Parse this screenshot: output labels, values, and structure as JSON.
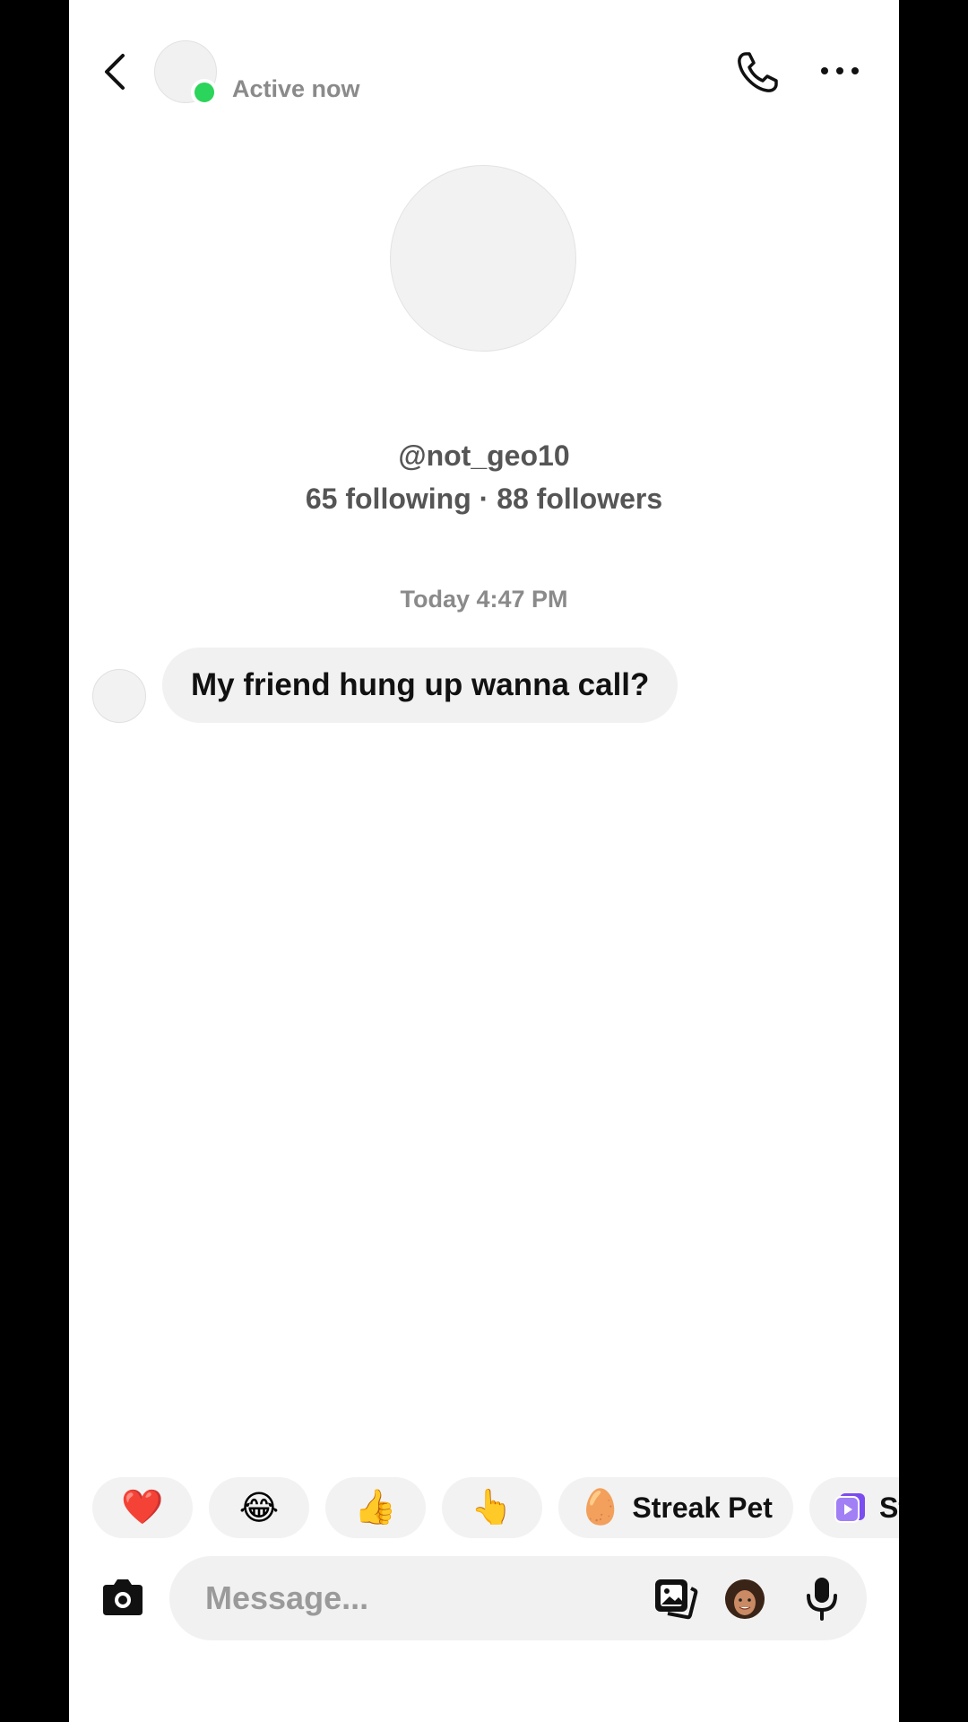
{
  "header": {
    "status_text": "Active now",
    "icons": {
      "back": "chevron-left-icon",
      "call": "phone-icon",
      "more": "more-horizontal-icon"
    }
  },
  "profile": {
    "username": "@not_geo10",
    "stats": "65 following · 88 followers"
  },
  "conversation": {
    "timestamp": "Today 4:47 PM",
    "messages": [
      {
        "text": "My friend hung up wanna call?"
      }
    ]
  },
  "quick_reactions": [
    {
      "emoji": "❤️",
      "name": "heart"
    },
    {
      "emoji": "😂",
      "name": "laughing"
    },
    {
      "emoji": "👍",
      "name": "thumbs-up"
    },
    {
      "emoji": "👆",
      "name": "pointing"
    },
    {
      "emoji": "🥚",
      "label": "Streak Pet"
    },
    {
      "label": "St"
    }
  ],
  "composer": {
    "placeholder": "Message...",
    "icons": {
      "camera": "camera-icon",
      "gallery": "gallery-icon",
      "avatar": "avatar-icon",
      "mic": "microphone-icon"
    }
  },
  "colors": {
    "online": "#2bd45a",
    "bubble": "#f1f1f1",
    "accent_purple": "#7b4cf0"
  }
}
